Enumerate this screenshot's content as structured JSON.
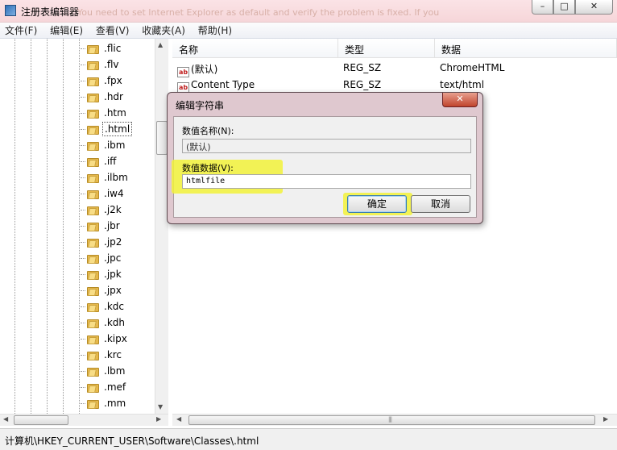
{
  "window": {
    "title": "注册表编辑器",
    "ghost_text": "You need to set Internet Explorer as default and verify the problem is fixed. If you",
    "min": "–",
    "max": "□",
    "close": "✕"
  },
  "menu": [
    "文件(F)",
    "编辑(E)",
    "查看(V)",
    "收藏夹(A)",
    "帮助(H)"
  ],
  "tree": {
    "items": [
      ".flic",
      ".flv",
      ".fpx",
      ".hdr",
      ".htm",
      ".html",
      ".ibm",
      ".iff",
      ".ilbm",
      ".iw4",
      ".j2k",
      ".jbr",
      ".jp2",
      ".jpc",
      ".jpk",
      ".jpx",
      ".kdc",
      ".kdh",
      ".kipx",
      ".krc",
      ".lbm",
      ".mef",
      ".mm"
    ],
    "selected": ".html"
  },
  "list": {
    "headers": [
      "名称",
      "类型",
      "数据"
    ],
    "rows": [
      {
        "name": "(默认)",
        "type": "REG_SZ",
        "data": "ChromeHTML"
      },
      {
        "name": "Content Type",
        "type": "REG_SZ",
        "data": "text/html"
      }
    ]
  },
  "dialog": {
    "title": "编辑字符串",
    "value_name_label": "数值名称(N):",
    "value_name": "(默认)",
    "value_data_label": "数值数据(V):",
    "value_data": "htmlfile",
    "ok": "确定",
    "cancel": "取消",
    "close": "✕"
  },
  "status": "计算机\\HKEY_CURRENT_USER\\Software\\Classes\\.html",
  "colors": {
    "highlight": "#f2f23a",
    "titlebar": "#f6d6d9",
    "dialog_frame": "#dfc8cf"
  }
}
